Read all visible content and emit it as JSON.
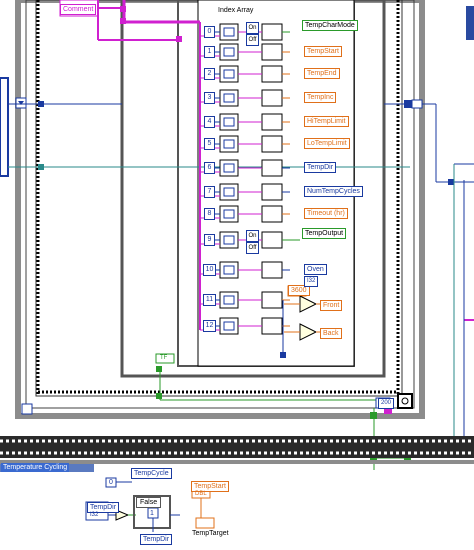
{
  "top_labels": {
    "comment": "Comment",
    "index_array": "Index Array"
  },
  "index_rows": [
    {
      "index": "0",
      "indicator": "TempCharMode",
      "kind": "onoff",
      "color": "green"
    },
    {
      "index": "1",
      "indicator": "TempStart",
      "kind": "numeric",
      "color": "orange"
    },
    {
      "index": "2",
      "indicator": "TempEnd",
      "kind": "numeric",
      "color": "orange"
    },
    {
      "index": "3",
      "indicator": "TempInc",
      "kind": "numeric",
      "color": "orange"
    },
    {
      "index": "4",
      "indicator": "HiTempLimit",
      "kind": "numeric",
      "color": "orange"
    },
    {
      "index": "5",
      "indicator": "LoTempLimit",
      "kind": "numeric",
      "color": "orange"
    },
    {
      "index": "6",
      "indicator": "TempDir",
      "kind": "numeric",
      "color": "blue"
    },
    {
      "index": "7",
      "indicator": "NumTempCycles",
      "kind": "numeric",
      "color": "blue"
    },
    {
      "index": "8",
      "indicator": "Timeout (hr)",
      "kind": "numeric",
      "color": "orange"
    },
    {
      "index": "9",
      "indicator": "TempOutput",
      "kind": "onoff",
      "color": "green"
    },
    {
      "index": "10",
      "indicator": "Oven",
      "kind": "numeric",
      "color": "blue"
    },
    {
      "index": "11",
      "indicator": "Front",
      "kind": "numeric",
      "color": "orange"
    },
    {
      "index": "12",
      "indicator": "Back",
      "kind": "numeric",
      "color": "orange"
    }
  ],
  "onoff_labels": {
    "on": "On",
    "off": "Off"
  },
  "constants": {
    "seconds_per_hour": "3600",
    "timeout_value": "200",
    "oven_type": "I32",
    "tempout_type": "TF"
  },
  "bottom": {
    "section_label": "Temperature Cycling",
    "tempcycle": "TempCycle",
    "tempcycle_value": "0",
    "tempstart": "TempStart",
    "tempstart_type": "DBL",
    "tempdir": "TempDir",
    "tempdir_type": "I32",
    "case_selector": "False",
    "case_value": "1",
    "tempdir_out": "TempDir",
    "temptarget": "TempTarget"
  },
  "colors": {
    "pink_wire": "#d020d0",
    "blue_wire": "#1a3aa0",
    "teal_wire": "#2a8a8a",
    "green_wire": "#2a9a2a",
    "orange_wire": "#e0701a",
    "frame_gray": "#8c8c8c"
  }
}
